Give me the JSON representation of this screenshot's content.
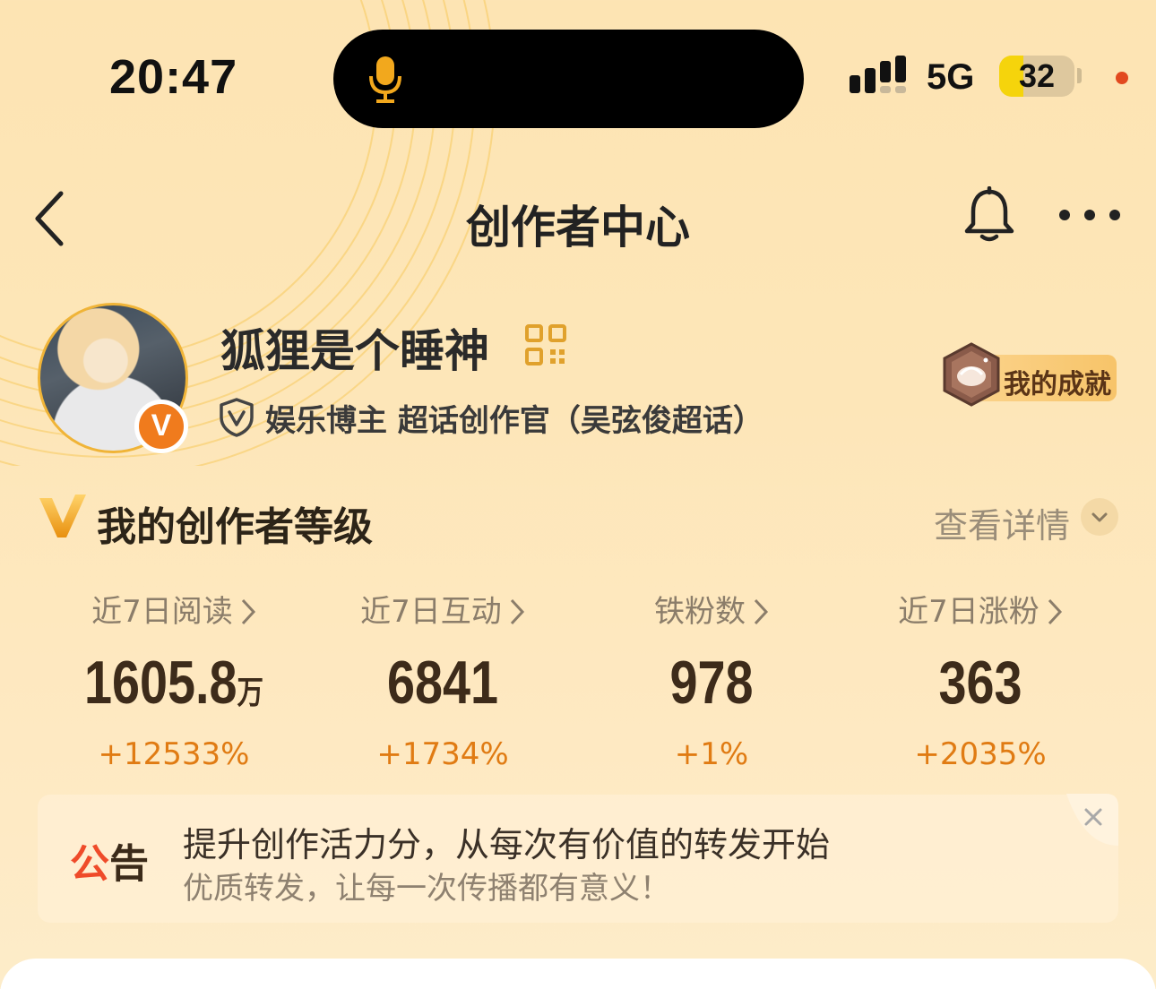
{
  "status_bar": {
    "time": "20:47",
    "network": "5G",
    "battery_percent": "32",
    "battery_level": 0.32,
    "icons": [
      "mic-icon",
      "signal-icon",
      "battery-icon",
      "recording-dot-icon"
    ]
  },
  "nav": {
    "title": "创作者中心",
    "icons": [
      "back-arrow-icon",
      "bell-icon",
      "more-icon"
    ]
  },
  "profile": {
    "username": "狐狸是个睡神",
    "avatar_badge": "V",
    "verification": "娱乐博主 超话创作官（吴弦俊超话）",
    "achievement_label": "我的成就",
    "icons": [
      "qr-code-icon",
      "shield-v-icon",
      "achievement-medal-icon"
    ]
  },
  "level": {
    "title": "我的创作者等级",
    "detail_label": "查看详情",
    "icons": [
      "v-logo-icon",
      "chevron-down-icon"
    ]
  },
  "stats": [
    {
      "label": "近7日阅读",
      "value": "1605.8",
      "unit": "万",
      "change": "+12533%"
    },
    {
      "label": "近7日互动",
      "value": "6841",
      "unit": "",
      "change": "+1734%"
    },
    {
      "label": "铁粉数",
      "value": "978",
      "unit": "",
      "change": "+1%"
    },
    {
      "label": "近7日涨粉",
      "value": "363",
      "unit": "",
      "change": "+2035%"
    }
  ],
  "announcement": {
    "tag_first": "公",
    "tag_rest": "告",
    "title": "提升创作活力分，从每次有价值的转发开始",
    "subtitle": "优质转发，让每一次传播都有意义！"
  },
  "colors": {
    "accent_orange": "#e07b13",
    "badge_orange": "#f07b1d",
    "notice_red": "#ef4b2a",
    "background": "#fde4b3"
  }
}
